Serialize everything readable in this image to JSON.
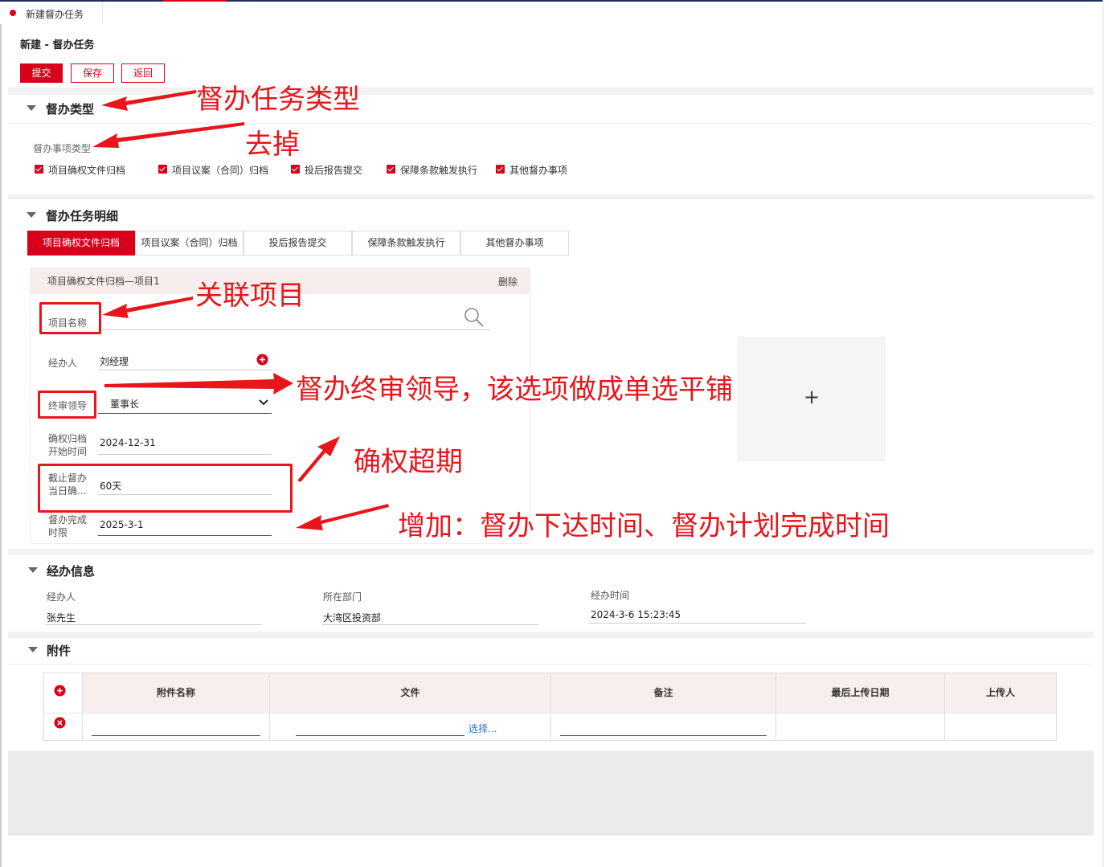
{
  "window": {
    "tab_title": "新建督办任务"
  },
  "page": {
    "title": "新建 - 督办任务"
  },
  "toolbar": {
    "submit_label": "提交",
    "save_label": "保存",
    "back_label": "返回"
  },
  "section_type": {
    "title": "督办类型",
    "field_label": "督办事项类型",
    "options": [
      "项目确权文件归档",
      "项目议案（合同）归档",
      "投后报告提交",
      "保障条款触发执行",
      "其他督办事项"
    ]
  },
  "section_detail": {
    "title": "督办任务明细",
    "tabs": [
      "项目确权文件归档",
      "项目议案（合同）归档",
      "投后报告提交",
      "保障条款触发执行",
      "其他督办事项"
    ],
    "card": {
      "header": "项目确权文件归档—项目1",
      "delete_label": "删除",
      "project_label": "项目名称",
      "handler_label": "经办人",
      "handler_value": "刘经理",
      "leader_label": "终审领导",
      "leader_value": "董事长",
      "start_label_1": "确权归档",
      "start_label_2": "开始时间",
      "start_value": "2024-12-31",
      "cutoff_label_1": "截止督办",
      "cutoff_label_2": "当日确...",
      "cutoff_value": "60天",
      "deadline_label_1": "督办完成",
      "deadline_label_2": "时限",
      "deadline_value": "2025-3-1"
    },
    "add_symbol": "+"
  },
  "section_handler": {
    "title": "经办信息",
    "handler_label": "经办人",
    "handler_value": "张先生",
    "dept_label": "所在部门",
    "dept_value": "大湾区投资部",
    "time_label": "经办时间",
    "time_value": "2024-3-6 15:23:45"
  },
  "section_attach": {
    "title": "附件",
    "columns": [
      "附件名称",
      "文件",
      "备注",
      "最后上传日期",
      "上传人"
    ],
    "choose_label": "选择..."
  },
  "annotations": {
    "a1": "督办任务类型",
    "a2": "去掉",
    "a3": "关联项目",
    "a4": "督办终审领导，该选项做成单选平铺",
    "a5": "确权超期",
    "a6": "增加：督办下达时间、督办计划完成时间"
  },
  "colors": {
    "accent": "#d9001b",
    "annotation": "#e8151b",
    "nav": "#1f2d59"
  }
}
